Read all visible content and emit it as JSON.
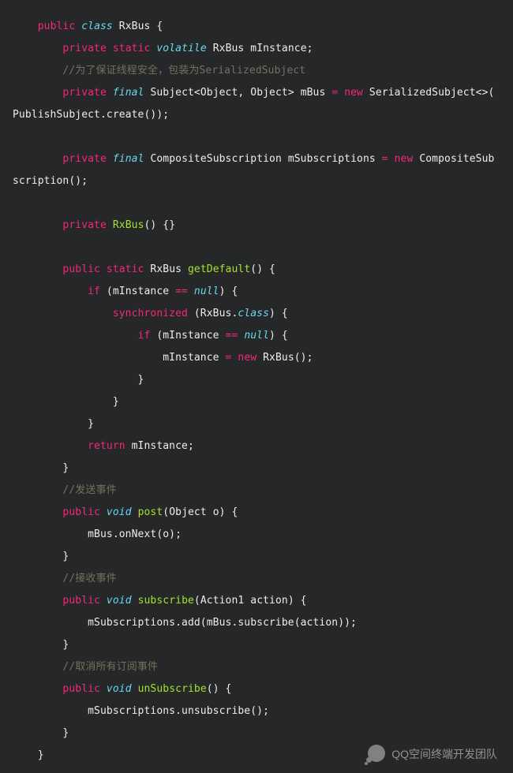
{
  "code": {
    "class_decl": {
      "public": "public",
      "class": "class",
      "name": "RxBus",
      "brace": " {"
    },
    "mInstance_decl": {
      "private": "private",
      "static": "static",
      "volatile": "volatile",
      "type": "RxBus",
      "name": " mInstance;"
    },
    "comment_thread": "//为了保证线程安全，包装为SerializedSubject",
    "mBus_decl": {
      "private": "private",
      "final": "final",
      "type": "Subject<Object, Object>",
      "name": " mBus ",
      "eq": "=",
      "sp": " ",
      "new": "new",
      "ctor": " SerializedSubject<>(",
      "tail": "PublishSubject.create());"
    },
    "mSubs_decl": {
      "private": "private",
      "final": "final",
      "type": "CompositeSubscription",
      "name": " mSubscriptions ",
      "eq": "=",
      "sp": " ",
      "new": "new",
      "ctor": " CompositeSub",
      "tail": "scription();"
    },
    "ctor_decl": {
      "private": "private",
      "type": "RxBus",
      "body": "() {}"
    },
    "getDefault": {
      "public": "public",
      "static": "static",
      "ret": "RxBus",
      "name": "getDefault",
      "sig": "() {",
      "if1": "if",
      "if1b": " (mInstance ",
      "eqeq": "==",
      "null1": " null",
      "if1c": ") {",
      "sync": "synchronized",
      "syncb": " (RxBus.",
      "cls": "class",
      "syncc": ") {",
      "if2": "if",
      "if2b": " (mInstance ",
      "eqeq2": "==",
      "null2": " null",
      "if2c": ") {",
      "assn": "mInstance ",
      "eq": "=",
      "sp": " ",
      "new": "new",
      "ctor": " RxBus();",
      "c1": "}",
      "c2": "}",
      "c3": "}",
      "ret2": "return",
      "retv": " mInstance;",
      "c4": "}"
    },
    "comment_post": "//发送事件",
    "post": {
      "public": "public",
      "void": "void",
      "name": "post",
      "sig": "(Object o) {",
      "body": "mBus.onNext(o);",
      "close": "}"
    },
    "comment_sub": "//接收事件",
    "subscribe": {
      "public": "public",
      "void": "void",
      "name": "subscribe",
      "sig": "(Action1 action) {",
      "body": "mSubscriptions.add(mBus.subscribe(action));",
      "close": "}"
    },
    "comment_unsub": "//取消所有订阅事件",
    "unSubscribe": {
      "public": "public",
      "void": "void",
      "name": "unSubscribe",
      "sig": "() {",
      "body": "mSubscriptions.unsubscribe();",
      "close": "}"
    },
    "class_close": "}"
  },
  "watermark": "QQ空间终端开发团队"
}
